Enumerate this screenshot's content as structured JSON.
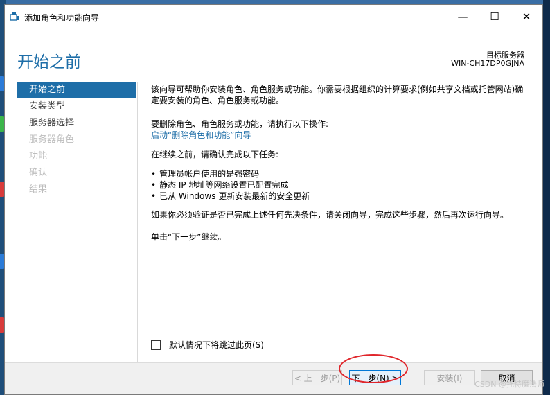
{
  "window": {
    "title": "添加角色和功能向导",
    "controls": {
      "minimize": "—",
      "maximize": "☐",
      "close": "✕"
    }
  },
  "header": {
    "page_title": "开始之前",
    "server_label": "目标服务器",
    "server_name": "WIN-CH17DP0GJNA"
  },
  "nav": {
    "items": [
      {
        "label": "开始之前",
        "state": "active"
      },
      {
        "label": "安装类型",
        "state": "normal"
      },
      {
        "label": "服务器选择",
        "state": "normal"
      },
      {
        "label": "服务器角色",
        "state": "disabled"
      },
      {
        "label": "功能",
        "state": "disabled"
      },
      {
        "label": "确认",
        "state": "disabled"
      },
      {
        "label": "结果",
        "state": "disabled"
      }
    ]
  },
  "content": {
    "intro": "该向导可帮助你安装角色、角色服务或功能。你需要根据组织的计算要求(例如共享文档或托管网站)确定要安装的角色、角色服务或功能。",
    "remove_hint": "要删除角色、角色服务或功能，请执行以下操作:",
    "remove_link": "启动“删除角色和功能”向导",
    "confirm_hint": "在继续之前，请确认完成以下任务:",
    "tasks": [
      "管理员帐户使用的是强密码",
      "静态 IP 地址等网络设置已配置完成",
      "已从 Windows 更新安装最新的安全更新"
    ],
    "prereq_note": "如果你必须验证是否已完成上述任何先决条件，请关闭向导，完成这些步骤，然后再次运行向导。",
    "next_instruction": "单击“下一步”继续。"
  },
  "skip_checkbox": {
    "label": "默认情况下将跳过此页(S)",
    "checked": false
  },
  "footer": {
    "prev": "< 上一步(P)",
    "next": "下一步(N) >",
    "install": "安装(I)",
    "cancel": "取消"
  },
  "watermark": "CSDN @托特魔法师",
  "colors": {
    "accent": "#1e6ea8",
    "annotation": "#e0262b"
  }
}
